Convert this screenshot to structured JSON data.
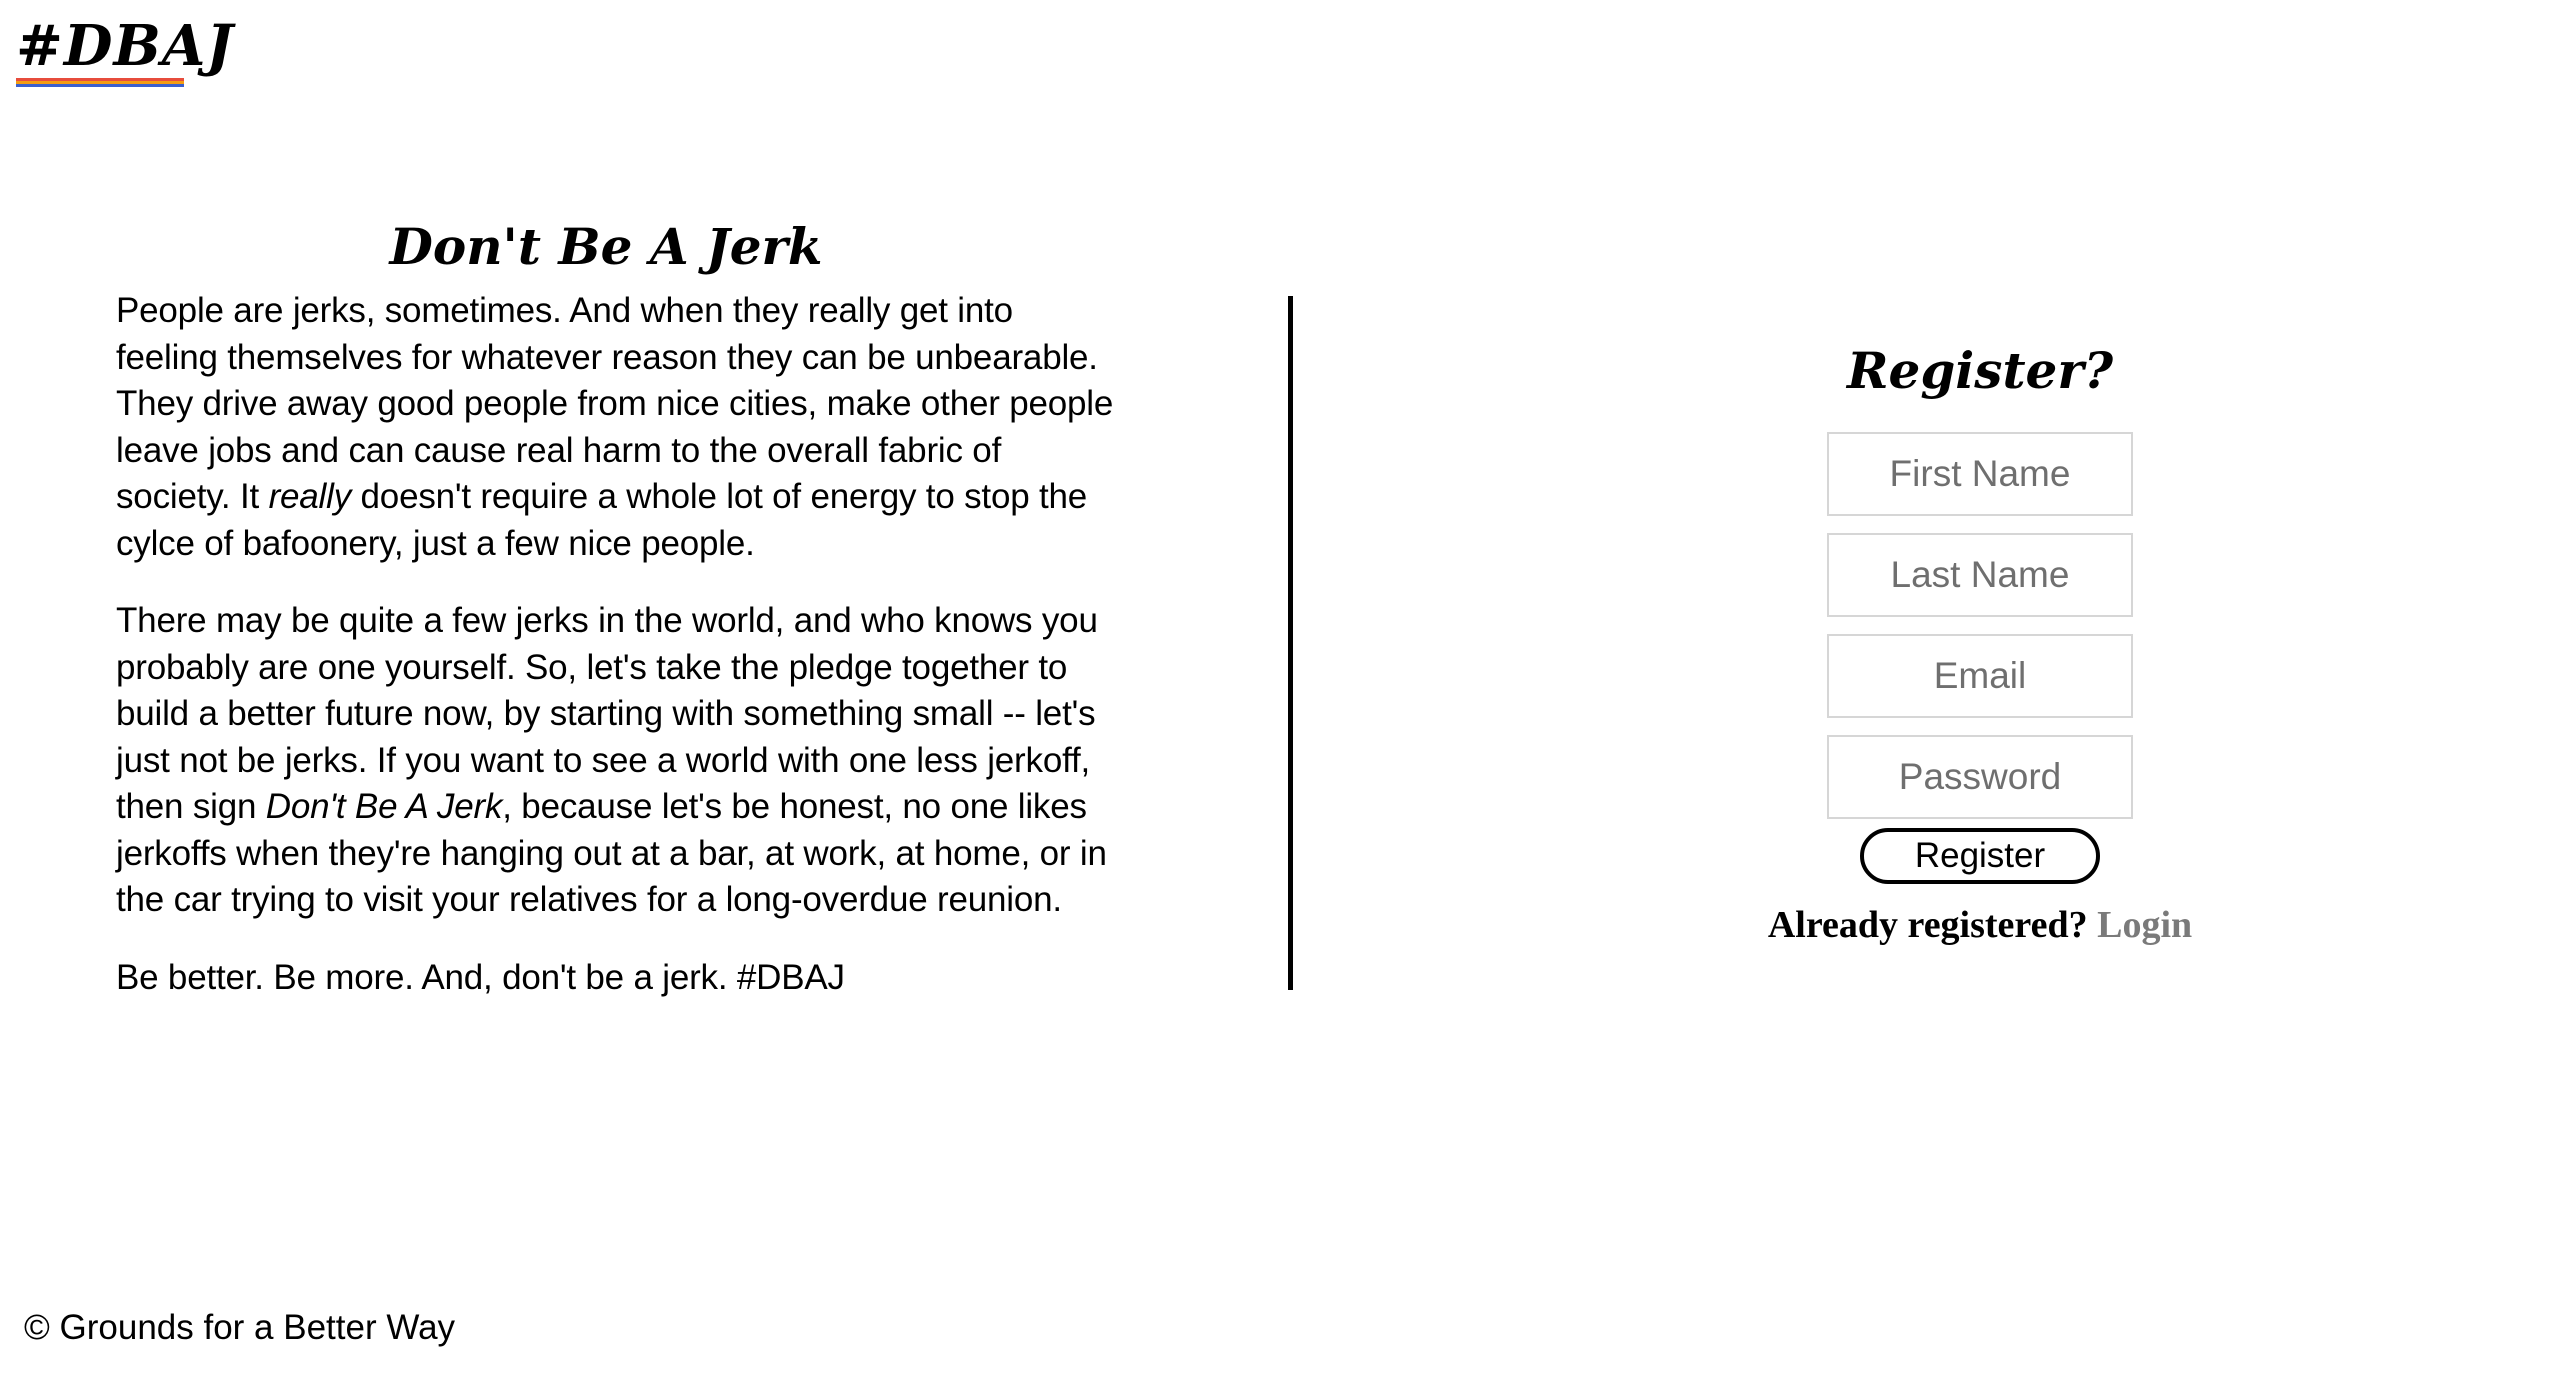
{
  "logo": {
    "text": "#DBAJ",
    "stripe_colors": [
      "#e74c3c",
      "#f39c12",
      "#3a5fcd"
    ]
  },
  "intro": {
    "title": "Don't Be A Jerk",
    "paragraph1": {
      "before": "People are jerks, sometimes. And when they really get into feeling themselves for whatever reason they can be unbearable. They drive away good people from nice cities, make other people leave jobs and can cause real harm to the overall fabric of society. It ",
      "emphasis": "really",
      "after": " doesn't require a whole lot of energy to stop the cylce of bafoonery, just a few nice people."
    },
    "paragraph2": {
      "before": "There may be quite a few jerks in the world, and who knows you probably are one yourself. So, let's take the pledge together to build a better future now, by starting with something small -- let's just not be jerks. If you want to see a world with one less jerkoff, then sign ",
      "emphasis": "Don't Be A Jerk",
      "after": ", because let's be honest, no one likes jerkoffs when they're hanging out at a bar, at work, at home, or in the car trying to visit your relatives for a long-overdue reunion."
    },
    "paragraph3": "Be better. Be more. And, don't be a jerk. #DBAJ"
  },
  "register": {
    "title": "Register?",
    "first_name_placeholder": "First Name",
    "last_name_placeholder": "Last Name",
    "email_placeholder": "Email",
    "password_placeholder": "Password",
    "button_label": "Register",
    "already_text": "Already registered?",
    "login_label": "Login"
  },
  "footer": {
    "text": "© Grounds for a Better Way"
  }
}
